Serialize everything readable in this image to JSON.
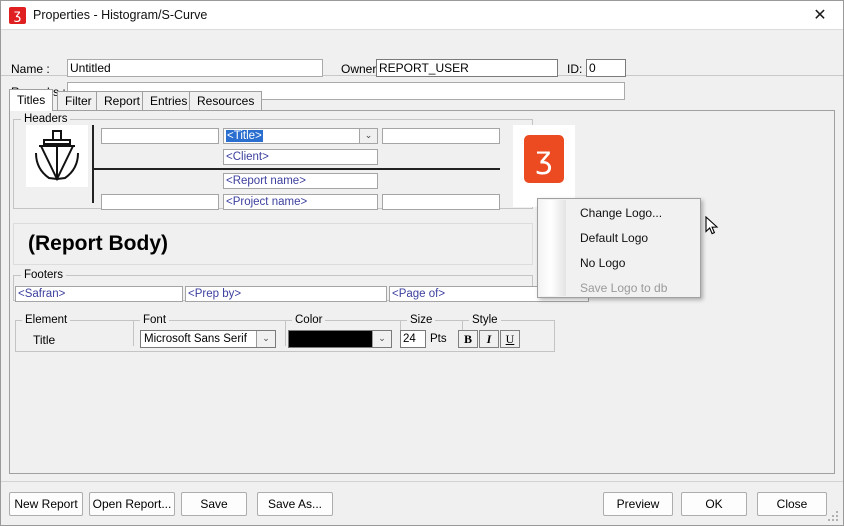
{
  "window": {
    "title": "Properties - Histogram/S-Curve",
    "app_icon": "safran-swirl-icon",
    "close_label": "✕"
  },
  "infobar": {
    "name_label": "Name :",
    "name_value": "Untitled",
    "owner_label": "Owner:",
    "owner_value": "REPORT_USER",
    "id_label": "ID:",
    "id_value": "0",
    "remarks_label": "Remarks :",
    "remarks_value": ""
  },
  "tabs": [
    {
      "label": "Titles",
      "active": true
    },
    {
      "label": "Filter",
      "active": false
    },
    {
      "label": "Report",
      "active": false
    },
    {
      "label": "Entries",
      "active": false
    },
    {
      "label": "Resources",
      "active": false
    }
  ],
  "headers": {
    "caption": "Headers",
    "ship_icon": "ship-icon",
    "fields": {
      "blank1": "",
      "title": "<Title>",
      "blank2": "",
      "client": "<Client>",
      "report_name": "<Report name>",
      "blank3": "",
      "project_name": "<Project name>",
      "blank4": ""
    },
    "title_dropdown_arrow": "⌄",
    "logo": {
      "name": "safran-logo",
      "glyph": "ʒ",
      "color": "#ec4a20"
    }
  },
  "report_body": {
    "label": "(Report Body)"
  },
  "footers": {
    "caption": "Footers",
    "safran": "<Safran>",
    "prep_by": "<Prep by>",
    "page_of": "<Page of>"
  },
  "format_bar": {
    "element_caption": "Element",
    "element_value": "Title",
    "font_caption": "Font",
    "font_value": "Microsoft Sans Serif",
    "color_caption": "Color",
    "color_value": "#000000",
    "size_caption": "Size",
    "size_value": "24",
    "pts_label": "Pts",
    "style_caption": "Style",
    "bold_label": "B",
    "italic_label": "I",
    "underline_label": "U",
    "dropdown_arrow": "⌄"
  },
  "context_menu": {
    "items": [
      {
        "label": "Change Logo...",
        "disabled": false
      },
      {
        "label": "Default Logo",
        "disabled": false
      },
      {
        "label": "No Logo",
        "disabled": false
      },
      {
        "label": "Save Logo to db",
        "disabled": true
      }
    ]
  },
  "bottom_buttons": {
    "new_report": "New Report",
    "open_report": "Open Report...",
    "save": "Save",
    "save_as": "Save As...",
    "preview": "Preview",
    "ok": "OK",
    "close": "Close"
  }
}
